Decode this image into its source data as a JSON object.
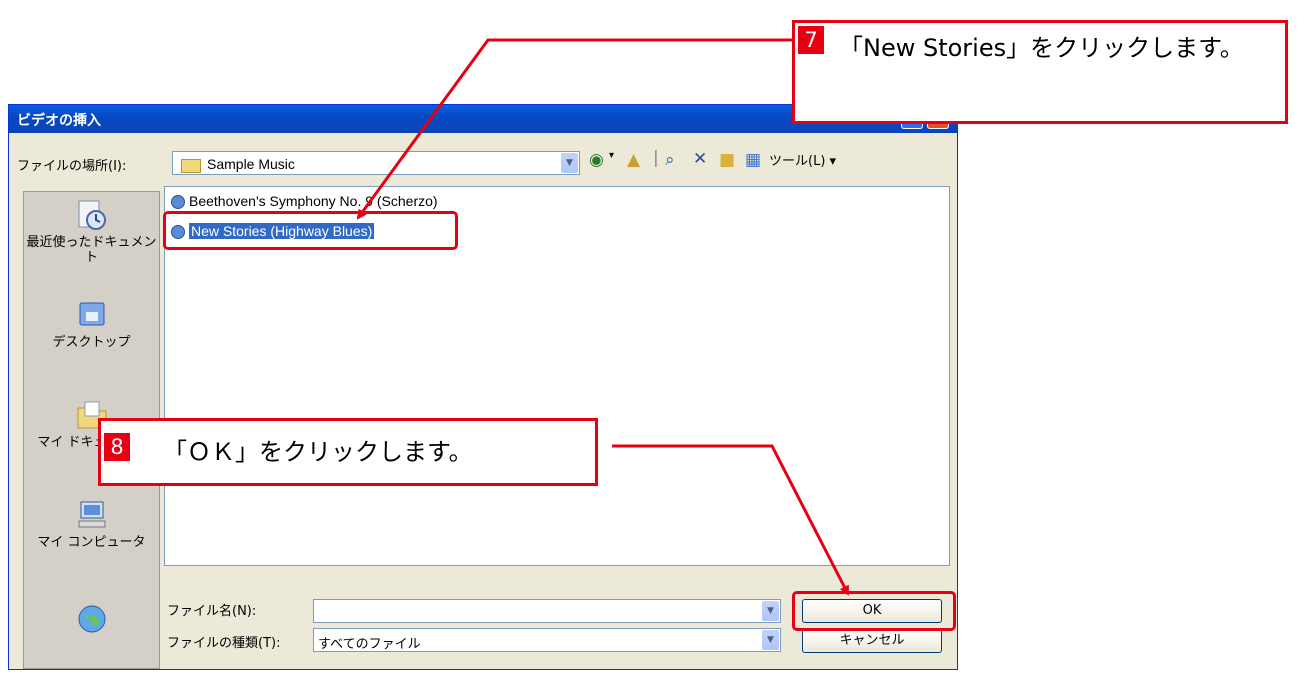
{
  "dialog": {
    "title": "ビデオの挿入",
    "help_btn": "?",
    "close_btn": "✕",
    "look_in_label": "ファイルの場所(I):",
    "look_in_value": "Sample Music",
    "tools_label": "ツール(L) ▾",
    "places": [
      {
        "label": "最近使ったドキュメント",
        "icon": "recent-documents-icon"
      },
      {
        "label": "デスクトップ",
        "icon": "desktop-icon"
      },
      {
        "label": "マイ ドキュメント",
        "icon": "my-documents-icon"
      },
      {
        "label": "マイ コンピュータ",
        "icon": "my-computer-icon"
      },
      {
        "label": "",
        "icon": "network-icon"
      }
    ],
    "files": [
      {
        "name": "Beethoven's Symphony No. 9 (Scherzo)"
      },
      {
        "name": "New Stories (Highway Blues)"
      }
    ],
    "filename_label": "ファイル名(N):",
    "filename_value": "",
    "filetype_label": "ファイルの種類(T):",
    "filetype_value": "すべてのファイル",
    "ok_label": "OK",
    "cancel_label": "キャンセル"
  },
  "notes": {
    "step7_num": "7",
    "step7_text": "「New Stories」をクリックします。",
    "step8_num": "8",
    "step8_text": "「ＯＫ」をクリックします。"
  },
  "colors": {
    "annotation": "#e60012",
    "selection": "#316ac5",
    "titlebar": "#0848c4"
  }
}
